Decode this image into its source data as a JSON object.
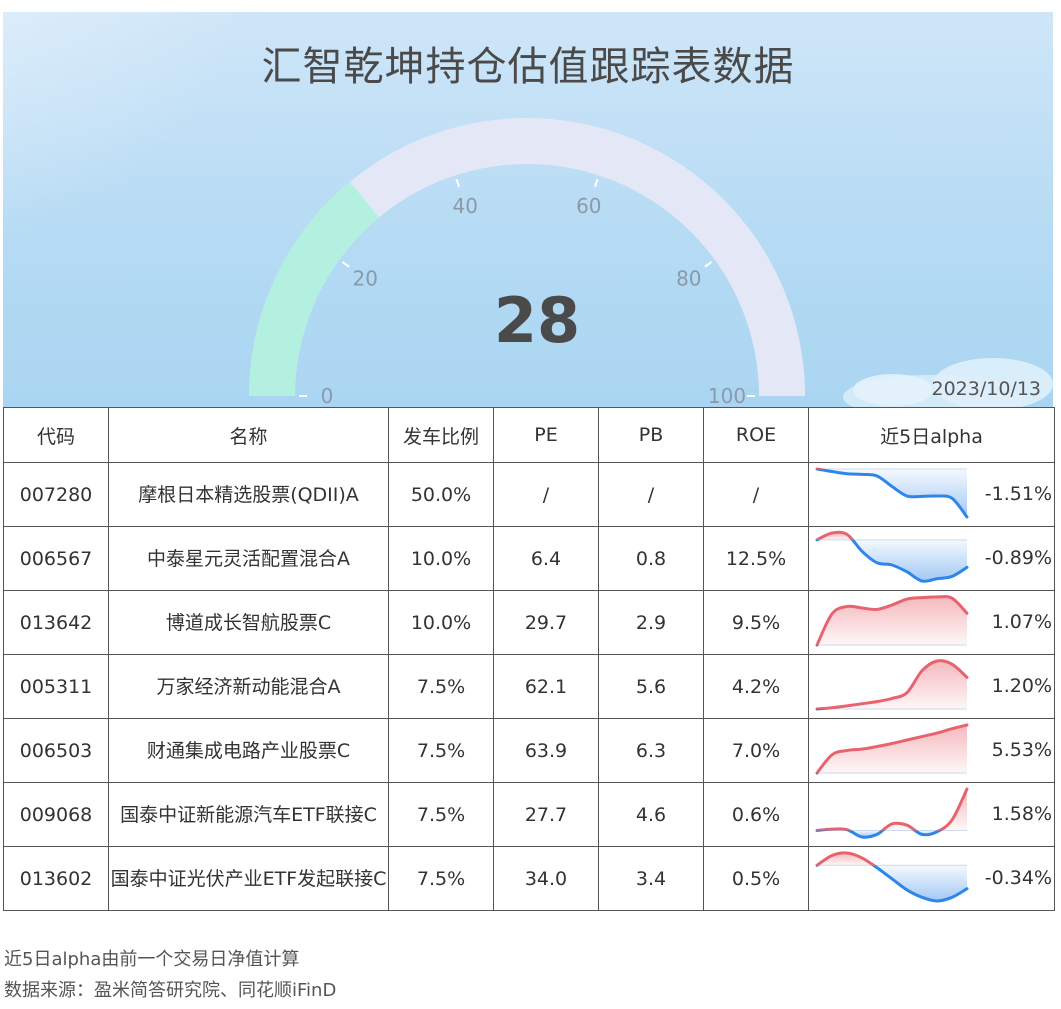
{
  "title": "汇智乾坤持仓估值跟踪表数据",
  "date": "2023/10/13",
  "colors": {
    "gauge_fill": "#b4f0e0",
    "gauge_track": "#e4e8f6",
    "up": "#e8636d",
    "down": "#2f86e8"
  },
  "chart_data": [
    {
      "type": "gauge",
      "value": 28,
      "min": 0,
      "max": 100,
      "ticks": [
        "0",
        "20",
        "40",
        "60",
        "80",
        "100"
      ]
    },
    {
      "type": "table",
      "columns": [
        "代码",
        "名称",
        "发车比例",
        "PE",
        "PB",
        "ROE",
        "近5日alpha"
      ],
      "rows": [
        {
          "code": "007280",
          "name": "摩根日本精选股票(QDII)A",
          "ratio": "50.0%",
          "pe": "/",
          "pb": "/",
          "roe": "/",
          "alpha": "-1.51%",
          "trend": [
            0.0,
            -0.08,
            -0.15,
            -0.17,
            -0.22,
            -0.55,
            -0.85,
            -0.86,
            -0.85,
            -0.92,
            -1.51
          ]
        },
        {
          "code": "006567",
          "name": "中泰星元灵活配置混合A",
          "ratio": "10.0%",
          "pe": "6.4",
          "pb": "0.8",
          "roe": "12.5%",
          "alpha": "-0.89%",
          "trend": [
            0.0,
            0.15,
            0.12,
            -0.25,
            -0.5,
            -0.55,
            -0.7,
            -0.9,
            -0.85,
            -0.8,
            -0.6
          ]
        },
        {
          "code": "013642",
          "name": "博道成长智航股票C",
          "ratio": "10.0%",
          "pe": "29.7",
          "pb": "2.9",
          "roe": "9.5%",
          "alpha": "1.07%",
          "trend": [
            0.0,
            1.05,
            1.3,
            1.25,
            1.2,
            1.35,
            1.55,
            1.6,
            1.62,
            1.58,
            1.07
          ]
        },
        {
          "code": "005311",
          "name": "万家经济新动能混合A",
          "ratio": "7.5%",
          "pe": "62.1",
          "pb": "5.6",
          "roe": "4.2%",
          "alpha": "1.20%",
          "trend": [
            0.0,
            0.05,
            0.12,
            0.2,
            0.28,
            0.4,
            0.62,
            1.45,
            1.82,
            1.7,
            1.2
          ]
        },
        {
          "code": "006503",
          "name": "财通集成电路产业股票C",
          "ratio": "7.5%",
          "pe": "63.9",
          "pb": "6.3",
          "roe": "7.0%",
          "alpha": "5.53%",
          "trend": [
            0.0,
            2.1,
            2.6,
            2.75,
            3.05,
            3.4,
            3.8,
            4.2,
            4.6,
            5.1,
            5.53
          ]
        },
        {
          "code": "009068",
          "name": "国泰中证新能源汽车ETF联接C",
          "ratio": "7.5%",
          "pe": "27.7",
          "pb": "4.6",
          "roe": "0.6%",
          "alpha": "1.58%",
          "trend": [
            0.0,
            0.05,
            0.03,
            -0.25,
            -0.15,
            0.25,
            0.2,
            -0.15,
            -0.05,
            0.4,
            1.58
          ]
        },
        {
          "code": "013602",
          "name": "国泰中证光伏产业ETF发起联接C",
          "ratio": "7.5%",
          "pe": "34.0",
          "pb": "3.4",
          "roe": "0.5%",
          "alpha": "-0.34%",
          "trend": [
            0.0,
            0.4,
            0.5,
            0.3,
            -0.1,
            -0.55,
            -1.0,
            -1.3,
            -1.45,
            -1.3,
            -0.95
          ]
        }
      ]
    }
  ],
  "notes": [
    "近5日alpha由前一个交易日净值计算",
    "数据来源：盈米简答研究院、同花顺iFinD"
  ]
}
